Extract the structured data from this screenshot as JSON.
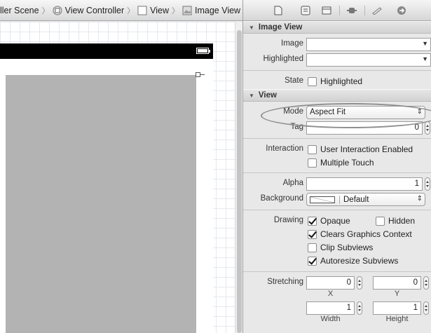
{
  "breadcrumb": {
    "items": [
      "ller Scene",
      "View Controller",
      "View",
      "Image View"
    ]
  },
  "canvas": {
    "accent_statusbar": "#000000",
    "image_view_fill": "#b3b3b3"
  },
  "inspector": {
    "toolbar_icons": [
      "file-icon",
      "quick-help-icon",
      "identity-icon",
      "attributes-icon",
      "size-ruler-icon",
      "connections-arrow-icon"
    ],
    "image_view_section": {
      "title": "Image View",
      "image_label": "Image",
      "image_value": "",
      "highlighted_label": "Highlighted",
      "highlighted_value": "",
      "state_label": "State",
      "state_option": "Highlighted",
      "state_checked": false
    },
    "view_section": {
      "title": "View",
      "mode_label": "Mode",
      "mode_value": "Aspect Fit",
      "tag_label": "Tag",
      "tag_value": "0",
      "interaction_label": "Interaction",
      "user_interaction": "User Interaction Enabled",
      "multiple_touch": "Multiple Touch",
      "alpha_label": "Alpha",
      "alpha_value": "1",
      "background_label": "Background",
      "background_value": "Default",
      "drawing_label": "Drawing",
      "opaque": "Opaque",
      "opaque_checked": true,
      "hidden": "Hidden",
      "hidden_checked": false,
      "clears_context": "Clears Graphics Context",
      "clears_checked": true,
      "clip_subviews": "Clip Subviews",
      "clip_checked": false,
      "autoresize": "Autoresize Subviews",
      "autoresize_checked": true,
      "stretching_label": "Stretching",
      "stretch_x": "0",
      "stretch_y": "0",
      "stretch_width": "1",
      "stretch_height": "1",
      "x_label": "X",
      "y_label": "Y",
      "width_label": "Width",
      "height_label": "Height"
    }
  }
}
